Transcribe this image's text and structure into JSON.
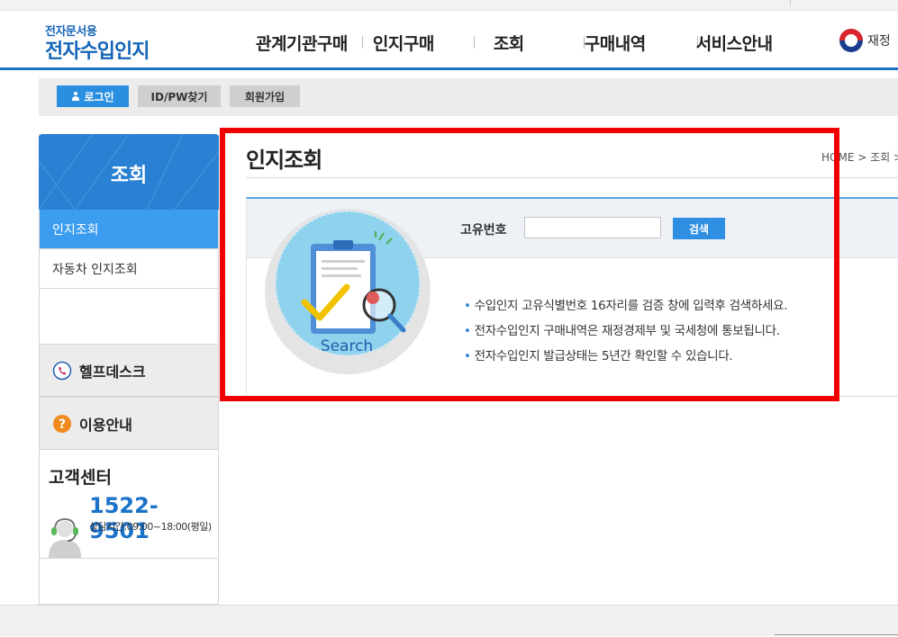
{
  "header": {
    "logo_sub": "전자문서용",
    "logo_main": "전자수입인지",
    "nav": [
      "관계기관구매",
      "인지구매",
      "조회",
      "구매내역",
      "서비스안내"
    ],
    "ministry": "재정"
  },
  "login_bar": {
    "login": "로그인",
    "find": "ID/PW찾기",
    "join": "회원가입"
  },
  "sidebar": {
    "title": "조회",
    "items": [
      {
        "label": "인지조회",
        "active": true
      },
      {
        "label": "자동차 인지조회",
        "active": false
      }
    ],
    "helpdesk": "헬프데스크",
    "guide": "이용안내",
    "customer_center": {
      "title": "고객센터",
      "phone": "1522-9501",
      "hours": "상담시간:09:00~18:00(평일)"
    }
  },
  "content": {
    "title": "인지조회",
    "breadcrumb": "HOME > 조회 >",
    "search": {
      "label": "고유번호",
      "value": "",
      "button": "검색",
      "illustration_label": "Search"
    },
    "notes": [
      "수입인지 고유식별번호 16자리를 검증 창에 입력후 검색하세요.",
      "전자수입인지 구매내역은 재정경제부 및 국세청에 통보됩니다.",
      "전자수입인지 발급상태는 5년간 확인할 수 있습니다."
    ]
  },
  "colors": {
    "brand_blue": "#1a73c9",
    "active_blue": "#3c9df0",
    "highlight_frame": "#f00000"
  }
}
